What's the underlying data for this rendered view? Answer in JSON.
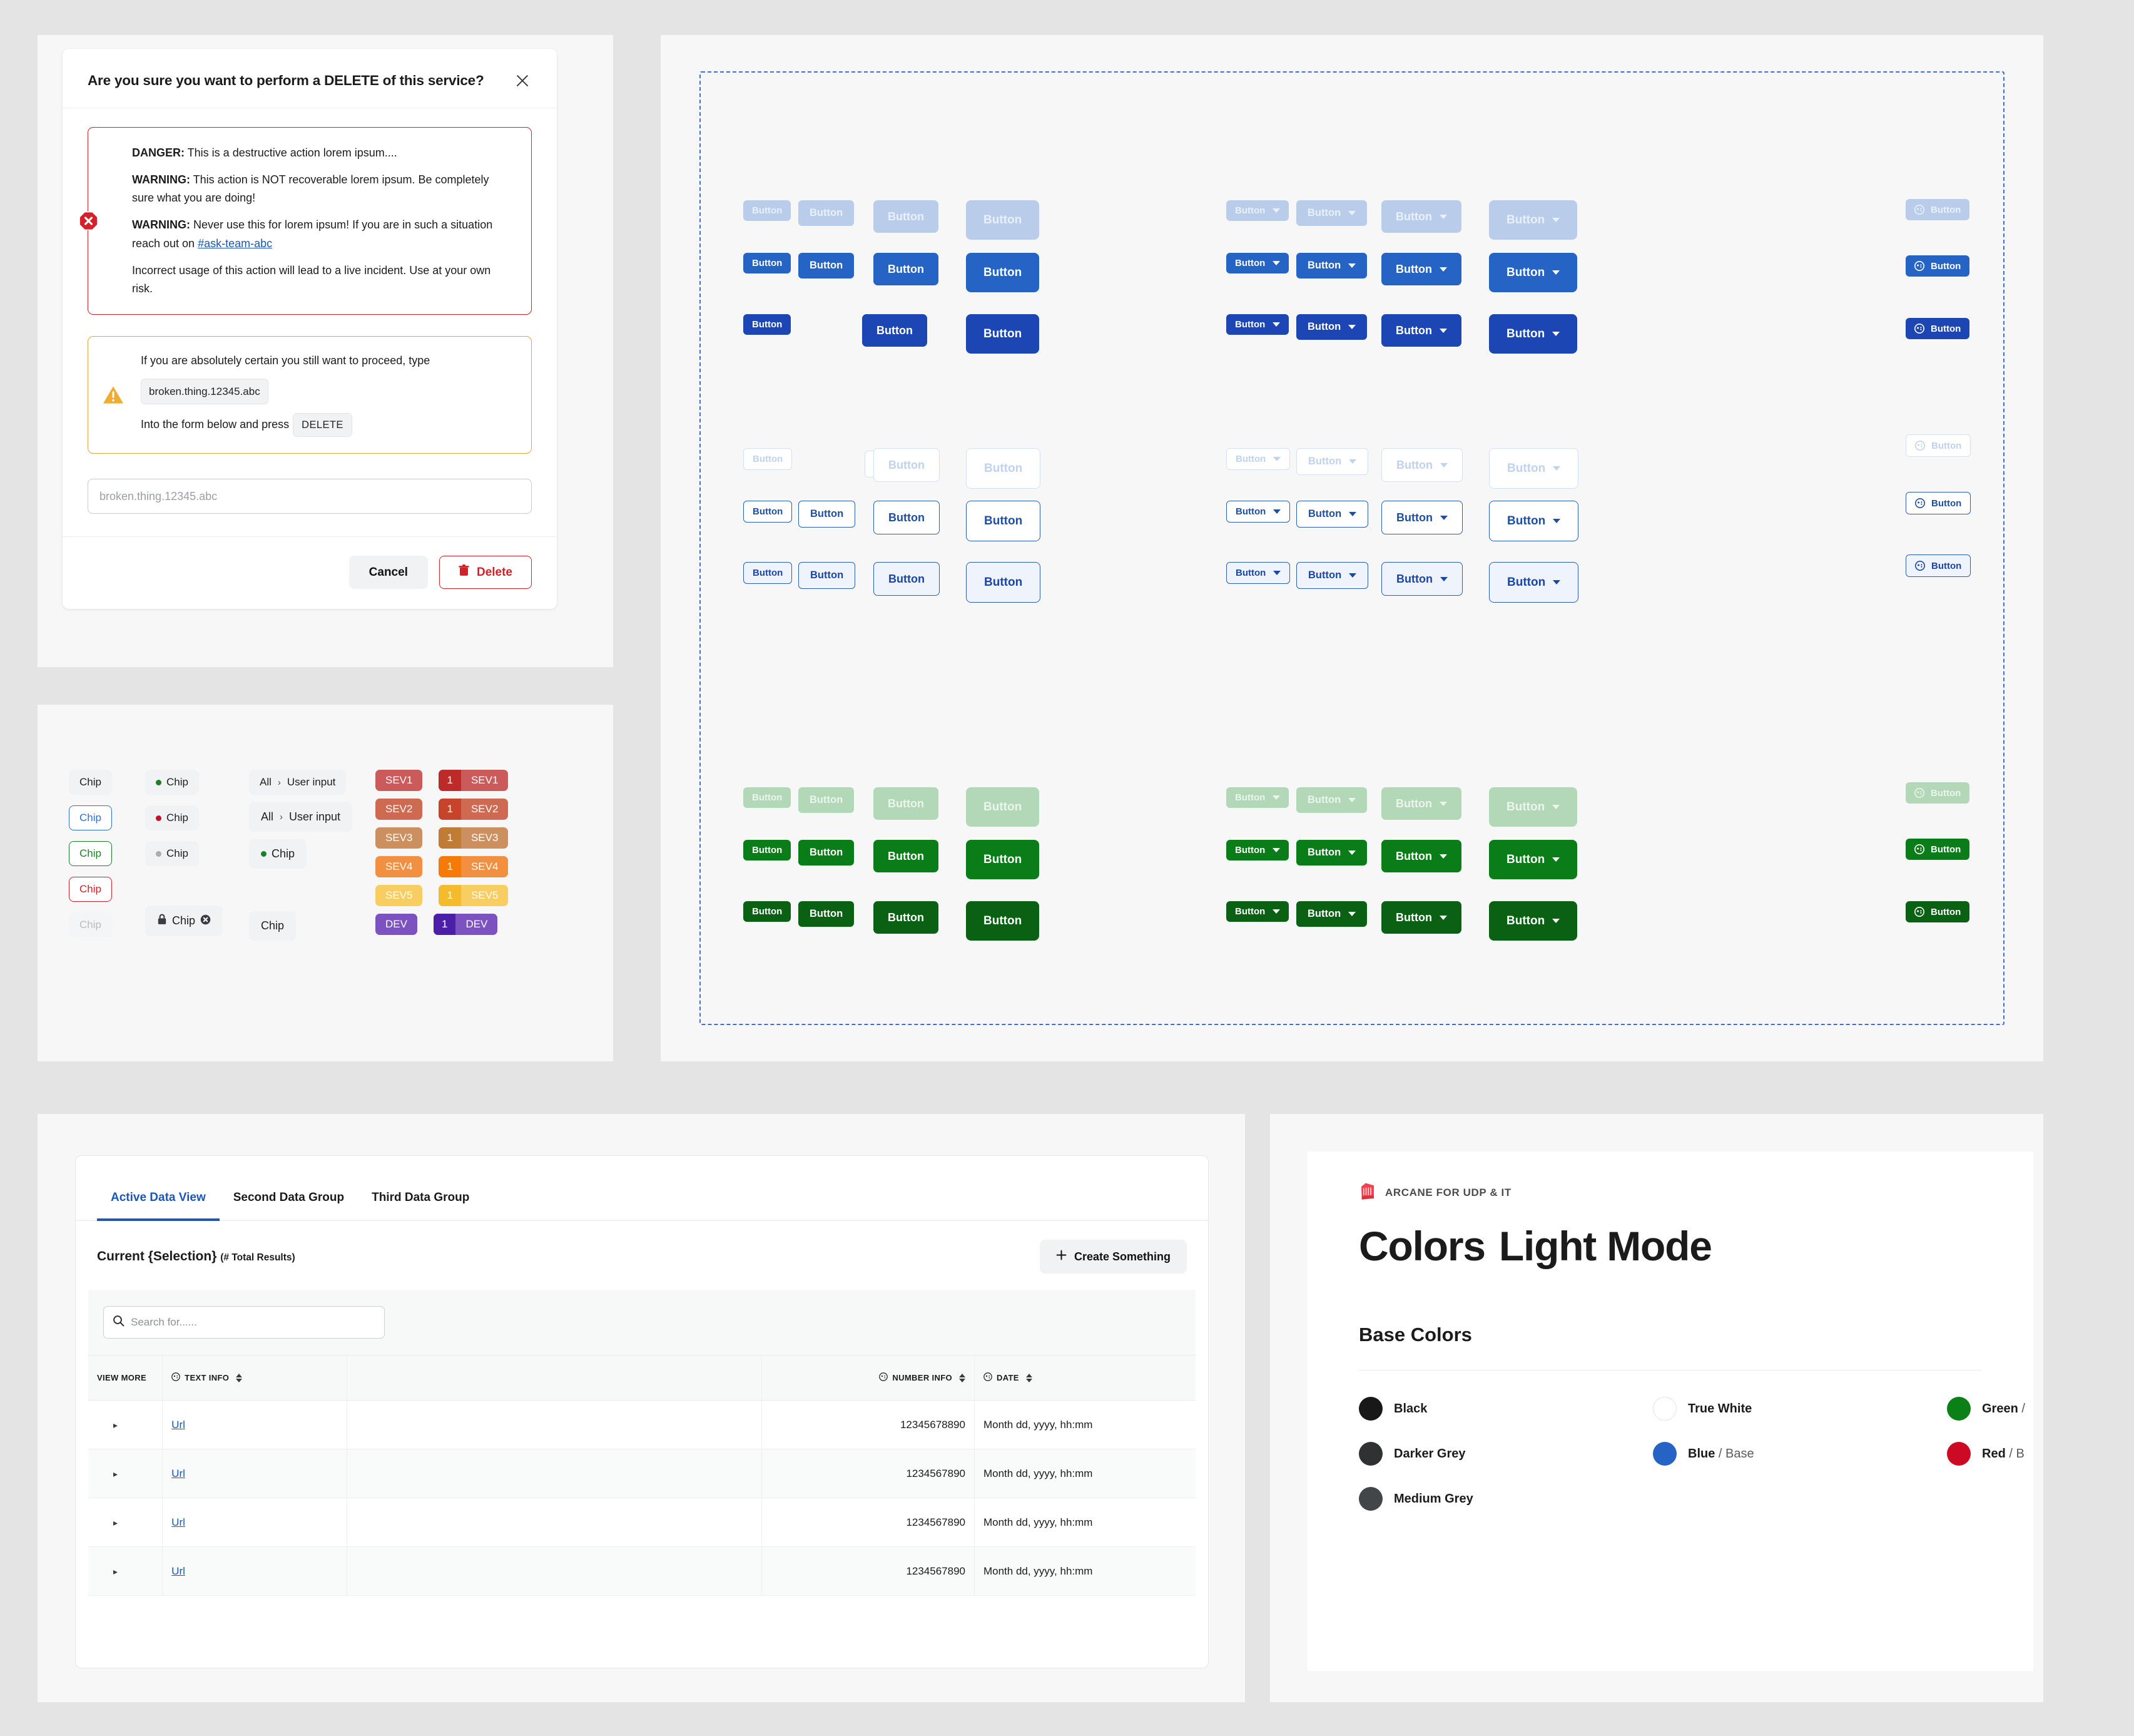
{
  "dialog": {
    "title": "Are you sure you want to perform a DELETE of this service?",
    "close_icon": "close-icon",
    "alert": {
      "icon": "error-octagon-icon",
      "line1_label": "DANGER:",
      "line1_text": " This is a destructive action lorem ipsum....",
      "line2_label": "WARNING:",
      "line2_text": " This action is NOT recoverable lorem ipsum. Be completely sure what you are doing!",
      "line3_label": "WARNING:",
      "line3_text": " Never use this for lorem ipsum! If you are in such a situation reach out on ",
      "line3_link": "#ask-team-abc",
      "line4_text": "Incorrect usage of this action will lead to a live incident. Use at your own risk."
    },
    "notice": {
      "icon": "warning-triangle-icon",
      "line1": "If you are absolutely certain you still want to proceed, type",
      "code": "broken.thing.12345.abc",
      "line2": "Into the form below and press",
      "kbd": "DELETE"
    },
    "input_placeholder": "broken.thing.12345.abc",
    "input_value": "",
    "cancel_label": "Cancel",
    "delete_label": "Delete",
    "delete_icon": "trash-icon"
  },
  "chips": {
    "col1": [
      {
        "label": "Chip",
        "style": "default"
      },
      {
        "label": "Chip",
        "style": "outline-blue"
      },
      {
        "label": "Chip",
        "style": "outline-green"
      },
      {
        "label": "Chip",
        "style": "outline-red"
      },
      {
        "label": "Chip",
        "style": "disabled"
      }
    ],
    "col2": [
      {
        "label": "Chip",
        "dot": "green"
      },
      {
        "label": "Chip",
        "dot": "red"
      },
      {
        "label": "Chip",
        "dot": "grey"
      }
    ],
    "col2_lock": {
      "label": "Chip",
      "lock_icon": "lock-icon",
      "close_icon": "chip-remove-icon"
    },
    "col3": [
      {
        "label_a": "All",
        "sep": "›",
        "label_b": "User input"
      },
      {
        "label_a": "All",
        "sep": "›",
        "label_b": "User input"
      }
    ],
    "col3_dot": {
      "label": "Chip",
      "dot": "green"
    },
    "col3_plain": {
      "label": "Chip"
    },
    "sev": [
      {
        "num": "1",
        "label": "SEV1",
        "bg": "#cb5a5a",
        "num_bg": "#bc2a2a"
      },
      {
        "num": "1",
        "label": "SEV2",
        "bg": "#cf6a52",
        "num_bg": "#c6442a"
      },
      {
        "num": "1",
        "label": "SEV3",
        "bg": "#cc9060",
        "num_bg": "#c07b34"
      },
      {
        "num": "1",
        "label": "SEV4",
        "bg": "#f09040",
        "num_bg": "#f57a09"
      },
      {
        "num": "1",
        "label": "SEV5",
        "bg": "#f8cd62",
        "num_bg": "#f4bb2e"
      },
      {
        "num": "1",
        "label": "DEV",
        "bg": "#7c52c0",
        "num_bg": "#4c1fa8"
      }
    ]
  },
  "buttons": {
    "label": "Button",
    "icon_name": "face-icon",
    "caret_icon": "chevron-down-icon",
    "sizes": [
      "xs",
      "sm",
      "md",
      "lg"
    ],
    "groups": [
      {
        "name": "filled-blue",
        "rows": [
          {
            "state": "disabled",
            "variant": "v-blue-dis"
          },
          {
            "state": "default",
            "variant": "v-blue"
          },
          {
            "state": "pressed",
            "variant": "v-blue-press"
          }
        ]
      },
      {
        "name": "outline-blue",
        "rows": [
          {
            "state": "disabled",
            "variant": "v-out-dis"
          },
          {
            "state": "default",
            "variant": "v-out"
          },
          {
            "state": "pressed",
            "variant": "v-out-press"
          }
        ]
      },
      {
        "name": "filled-green",
        "rows": [
          {
            "state": "disabled",
            "variant": "v-green-dis"
          },
          {
            "state": "default",
            "variant": "v-green"
          },
          {
            "state": "pressed",
            "variant": "v-green-press"
          }
        ]
      }
    ]
  },
  "data_panel": {
    "tabs": [
      {
        "label": "Active Data View",
        "active": true
      },
      {
        "label": "Second Data Group",
        "active": false
      },
      {
        "label": "Third Data Group",
        "active": false
      }
    ],
    "selection_title": "Current {Selection}",
    "selection_sub": "(# Total Results)",
    "create_label": "Create Something",
    "create_icon": "plus-icon",
    "search_placeholder": "Search for......",
    "search_value": "",
    "search_icon": "search-icon",
    "columns": [
      {
        "key": "view",
        "label": "VIEW MORE",
        "icon": null,
        "sortable": false,
        "align": "left"
      },
      {
        "key": "text",
        "label": "TEXT INFO",
        "icon": "info-icon",
        "sortable": true,
        "align": "left"
      },
      {
        "key": "blank",
        "label": "",
        "icon": null,
        "sortable": false,
        "align": "left"
      },
      {
        "key": "num",
        "label": "NUMBER INFO",
        "icon": "info-icon",
        "sortable": true,
        "align": "right"
      },
      {
        "key": "date",
        "label": "DATE",
        "icon": "info-icon",
        "sortable": true,
        "align": "left"
      }
    ],
    "rows": [
      {
        "expand": "›",
        "text": "Url",
        "blank": "",
        "num": "12345678890",
        "date": "Month dd, yyyy, hh:mm"
      },
      {
        "expand": "›",
        "text": "Url",
        "blank": "",
        "num": "1234567890",
        "date": "Month dd, yyyy, hh:mm"
      },
      {
        "expand": "›",
        "text": "Url",
        "blank": "",
        "num": "1234567890",
        "date": "Month dd, yyyy, hh:mm"
      },
      {
        "expand": "›",
        "text": "Url",
        "blank": "",
        "num": "1234567890",
        "date": "Month dd, yyyy, hh:mm"
      }
    ]
  },
  "colors_panel": {
    "brand": "ARCANE FOR  UDP & IT",
    "brand_icon": "arcane-fist-logo",
    "title_a": "Colors",
    "title_b": "Light Mode",
    "section": "Base Colors",
    "swatches": [
      {
        "name": "Black",
        "hex": "#181818",
        "label": "Black",
        "muted": ""
      },
      {
        "name": "True White",
        "hex": "#ffffff",
        "label": "True White",
        "muted": ""
      },
      {
        "name": "Green",
        "hex": "#0b8017",
        "label": "Green",
        "muted": " /"
      },
      {
        "name": "Darker Grey",
        "hex": "#2f3133",
        "label": "Darker Grey",
        "muted": ""
      },
      {
        "name": "Blue Base",
        "hex": "#2563c4",
        "label": "Blue",
        "muted": " / Base"
      },
      {
        "name": "Red",
        "hex": "#cc0a24",
        "label": "Red",
        "muted": " / B"
      },
      {
        "name": "Medium Grey",
        "hex": "#434648",
        "label": "Medium Grey",
        "muted": ""
      }
    ]
  },
  "theme": {
    "page_bg": "#e4e4e4",
    "panel_bg": "#f7f7f7",
    "blue": "#2563c4",
    "blue_press": "#1b46b4",
    "green": "#0b7d18",
    "red": "#d32029",
    "amber": "#e8a33d",
    "link": "#1b56b8"
  }
}
